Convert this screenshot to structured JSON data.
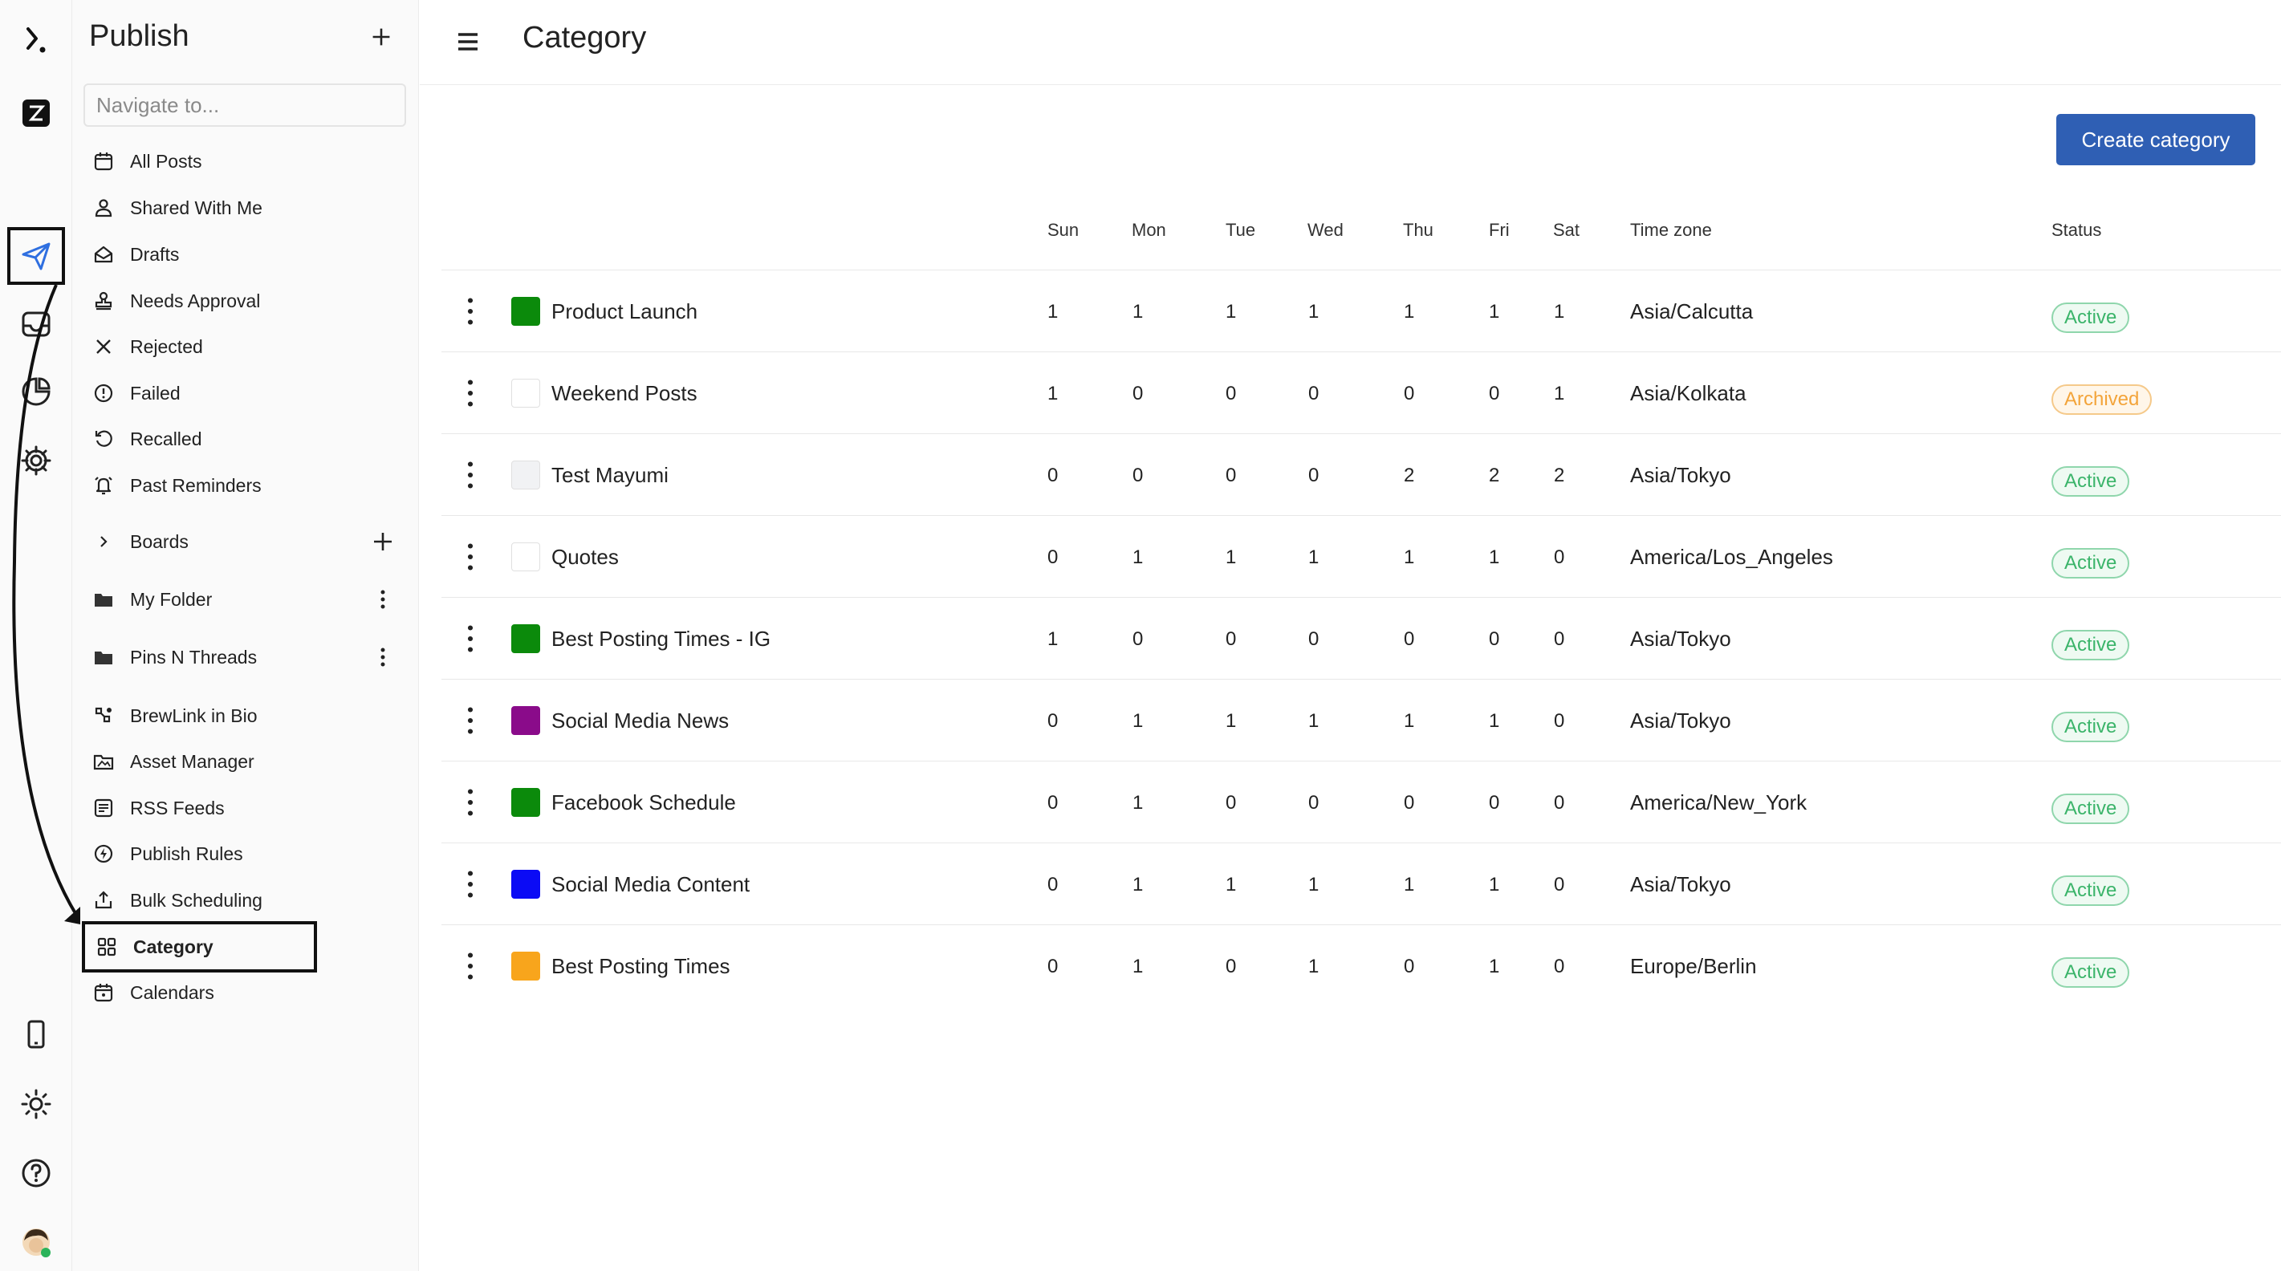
{
  "sidebar": {
    "title": "Publish",
    "search_placeholder": "Navigate to...",
    "items": [
      {
        "label": "All Posts"
      },
      {
        "label": "Shared With Me"
      },
      {
        "label": "Drafts"
      },
      {
        "label": "Needs Approval"
      },
      {
        "label": "Rejected"
      },
      {
        "label": "Failed"
      },
      {
        "label": "Recalled"
      },
      {
        "label": "Past Reminders"
      }
    ],
    "boards": {
      "label": "Boards"
    },
    "folders": [
      {
        "label": "My Folder"
      },
      {
        "label": "Pins N Threads"
      }
    ],
    "tools": [
      {
        "label": "BrewLink in Bio"
      },
      {
        "label": "Asset Manager"
      },
      {
        "label": "RSS Feeds"
      },
      {
        "label": "Publish Rules"
      },
      {
        "label": "Bulk Scheduling"
      },
      {
        "label": "Category"
      },
      {
        "label": "Calendars"
      }
    ]
  },
  "header": {
    "title": "Category",
    "create_label": "Create category"
  },
  "table": {
    "columns": [
      "Sun",
      "Mon",
      "Tue",
      "Wed",
      "Thu",
      "Fri",
      "Sat",
      "Time zone",
      "Status"
    ],
    "rows": [
      {
        "name": "Product Launch",
        "color": "#0b8a0b",
        "days": [
          "1",
          "1",
          "1",
          "1",
          "1",
          "1",
          "1"
        ],
        "tz": "Asia/Calcutta",
        "status": "Active"
      },
      {
        "name": "Weekend Posts",
        "color": "#ffffff",
        "days": [
          "1",
          "0",
          "0",
          "0",
          "0",
          "0",
          "1"
        ],
        "tz": "Asia/Kolkata",
        "status": "Archived"
      },
      {
        "name": "Test Mayumi",
        "color": "#f1f2f4",
        "days": [
          "0",
          "0",
          "0",
          "0",
          "2",
          "2",
          "2"
        ],
        "tz": "Asia/Tokyo",
        "status": "Active"
      },
      {
        "name": "Quotes",
        "color": "#ffffff",
        "days": [
          "0",
          "1",
          "1",
          "1",
          "1",
          "1",
          "0"
        ],
        "tz": "America/Los_Angeles",
        "status": "Active"
      },
      {
        "name": "Best Posting Times - IG",
        "color": "#0b8a0b",
        "days": [
          "1",
          "0",
          "0",
          "0",
          "0",
          "0",
          "0"
        ],
        "tz": "Asia/Tokyo",
        "status": "Active"
      },
      {
        "name": "Social Media News",
        "color": "#8a0b8a",
        "days": [
          "0",
          "1",
          "1",
          "1",
          "1",
          "1",
          "0"
        ],
        "tz": "Asia/Tokyo",
        "status": "Active"
      },
      {
        "name": "Facebook Schedule",
        "color": "#0b8a0b",
        "days": [
          "0",
          "1",
          "0",
          "0",
          "0",
          "0",
          "0"
        ],
        "tz": "America/New_York",
        "status": "Active"
      },
      {
        "name": "Social Media Content",
        "color": "#0b0bf5",
        "days": [
          "0",
          "1",
          "1",
          "1",
          "1",
          "1",
          "0"
        ],
        "tz": "Asia/Tokyo",
        "status": "Active"
      },
      {
        "name": "Best Posting Times",
        "color": "#f8a51c",
        "days": [
          "0",
          "1",
          "0",
          "1",
          "0",
          "1",
          "0"
        ],
        "tz": "Europe/Berlin",
        "status": "Active"
      }
    ]
  },
  "icons": {
    "rail": [
      "logo-icon",
      "brand-badge-icon",
      "publish-icon",
      "inbox-icon",
      "analytics-icon",
      "settings-icon",
      "mobile-icon",
      "theme-icon",
      "help-icon",
      "user-avatar"
    ]
  },
  "colors": {
    "accent": "#2f5fb4",
    "active": "#3bb46a",
    "archived": "#f3a43a"
  }
}
